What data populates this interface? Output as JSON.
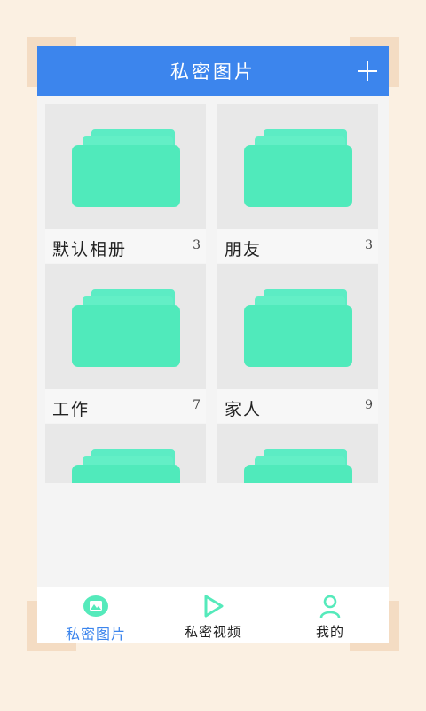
{
  "header": {
    "title": "私密图片"
  },
  "albums": [
    {
      "name": "默认相册",
      "count": "3"
    },
    {
      "name": "朋友",
      "count": "3"
    },
    {
      "name": "工作",
      "count": "7"
    },
    {
      "name": "家人",
      "count": "9"
    },
    {
      "name": "",
      "count": ""
    },
    {
      "name": "",
      "count": ""
    }
  ],
  "tabs": [
    {
      "label": "私密图片",
      "icon": "photo-icon",
      "active": true
    },
    {
      "label": "私密视频",
      "icon": "play-icon",
      "active": false
    },
    {
      "label": "我的",
      "icon": "user-icon",
      "active": false
    }
  ],
  "colors": {
    "header": "#3c85ed",
    "folder": "#55ecbf",
    "tab_active": "#3c85ed",
    "background": "#fbf0e2"
  }
}
